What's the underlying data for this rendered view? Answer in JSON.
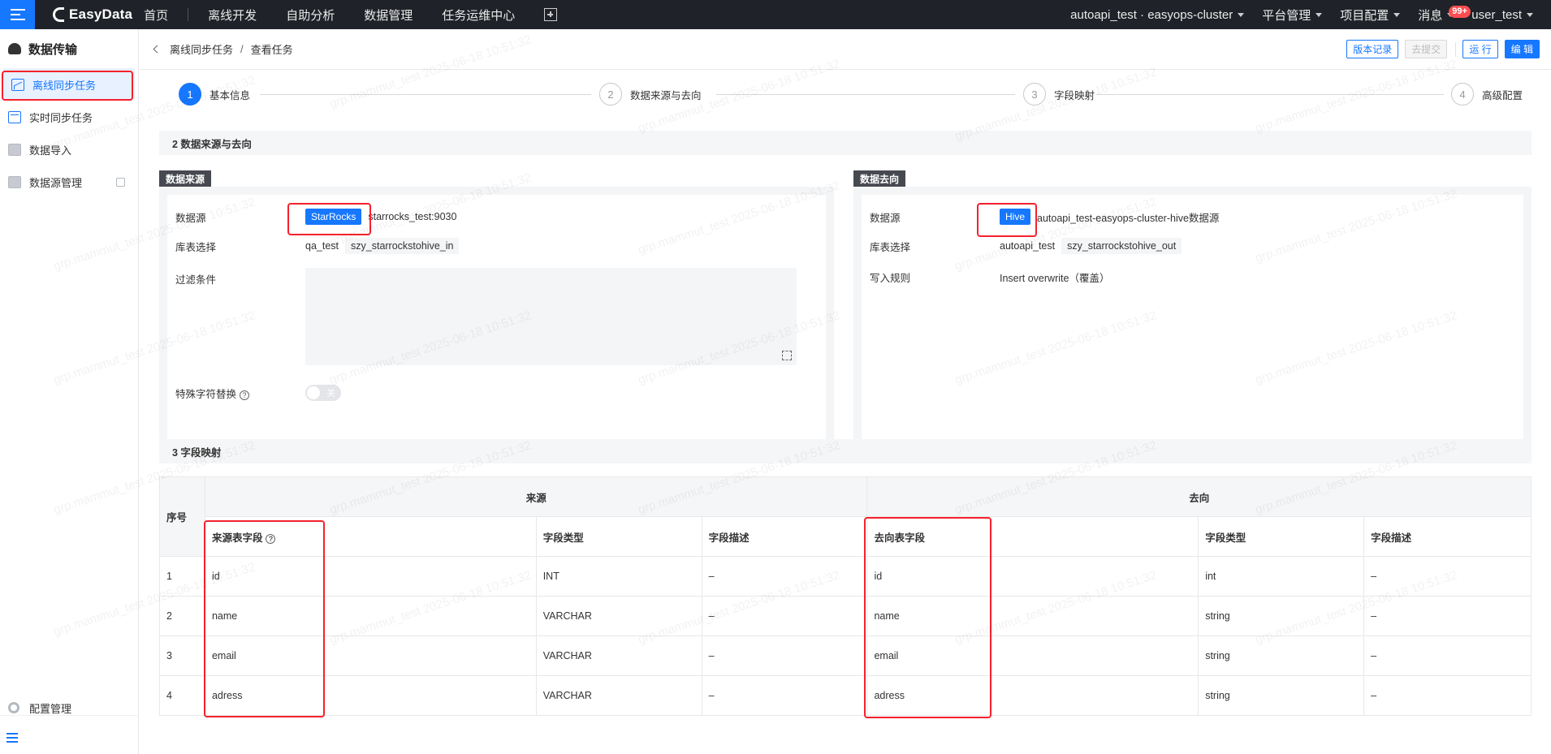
{
  "topnav": {
    "brand": "EasyData",
    "items": [
      "首页",
      "离线开发",
      "自助分析",
      "数据管理",
      "任务运维中心"
    ],
    "right": {
      "project": "autoapi_test · easyops-cluster",
      "platform": "平台管理",
      "project_config": "项目配置",
      "messages": "消息",
      "badge": "99+",
      "user": "user_test"
    }
  },
  "sidebar": {
    "title": "数据传输",
    "items": [
      {
        "label": "离线同步任务"
      },
      {
        "label": "实时同步任务"
      },
      {
        "label": "数据导入"
      },
      {
        "label": "数据源管理"
      }
    ],
    "config": "配置管理"
  },
  "header": {
    "breadcrumb_parent": "离线同步任务",
    "breadcrumb_sep": "/",
    "breadcrumb_current": "查看任务",
    "buttons": {
      "version": "版本记录",
      "submit": "去提交",
      "run": "运 行",
      "edit": "编 辑"
    }
  },
  "steps": [
    {
      "num": "1",
      "label": "基本信息"
    },
    {
      "num": "2",
      "label": "数据来源与去向"
    },
    {
      "num": "3",
      "label": "字段映射"
    },
    {
      "num": "4",
      "label": "高级配置"
    }
  ],
  "section2": {
    "title": "2 数据来源与去向",
    "source": {
      "tag": "数据来源",
      "datasource_label": "数据源",
      "datasource_type": "StarRocks",
      "datasource_name": "starrocks_test:9030",
      "table_label": "库表选择",
      "db": "qa_test",
      "table": "szy_starrockstohive_in",
      "filter_label": "过滤条件",
      "special_label": "特殊字符替换",
      "toggle_text": "关"
    },
    "target": {
      "tag": "数据去向",
      "datasource_label": "数据源",
      "datasource_type": "Hive",
      "datasource_name": "autoapi_test-easyops-cluster-hive数据源",
      "table_label": "库表选择",
      "db": "autoapi_test",
      "table": "szy_starrockstohive_out",
      "write_label": "写入规则",
      "write_value": "Insert overwrite（覆盖）"
    }
  },
  "section3": {
    "title": "3 字段映射",
    "headers": {
      "index": "序号",
      "source": "来源",
      "target": "去向",
      "src_field": "来源表字段",
      "src_type": "字段类型",
      "src_desc": "字段描述",
      "tgt_field": "去向表字段",
      "tgt_type": "字段类型",
      "tgt_desc": "字段描述"
    },
    "rows": [
      {
        "idx": "1",
        "src": "id",
        "stype": "INT",
        "sdesc": "–",
        "tgt": "id",
        "ttype": "int",
        "tdesc": "–"
      },
      {
        "idx": "2",
        "src": "name",
        "stype": "VARCHAR",
        "sdesc": "–",
        "tgt": "name",
        "ttype": "string",
        "tdesc": "–"
      },
      {
        "idx": "3",
        "src": "email",
        "stype": "VARCHAR",
        "sdesc": "–",
        "tgt": "email",
        "ttype": "string",
        "tdesc": "–"
      },
      {
        "idx": "4",
        "src": "adress",
        "stype": "VARCHAR",
        "sdesc": "–",
        "tgt": "adress",
        "ttype": "string",
        "tdesc": "–"
      }
    ]
  },
  "watermark": "grp.mammut_test 2025-06-18 10:51:32",
  "colors": {
    "primary": "#1677ff",
    "highlight": "#f5222d",
    "nav_bg": "#1f2228"
  }
}
